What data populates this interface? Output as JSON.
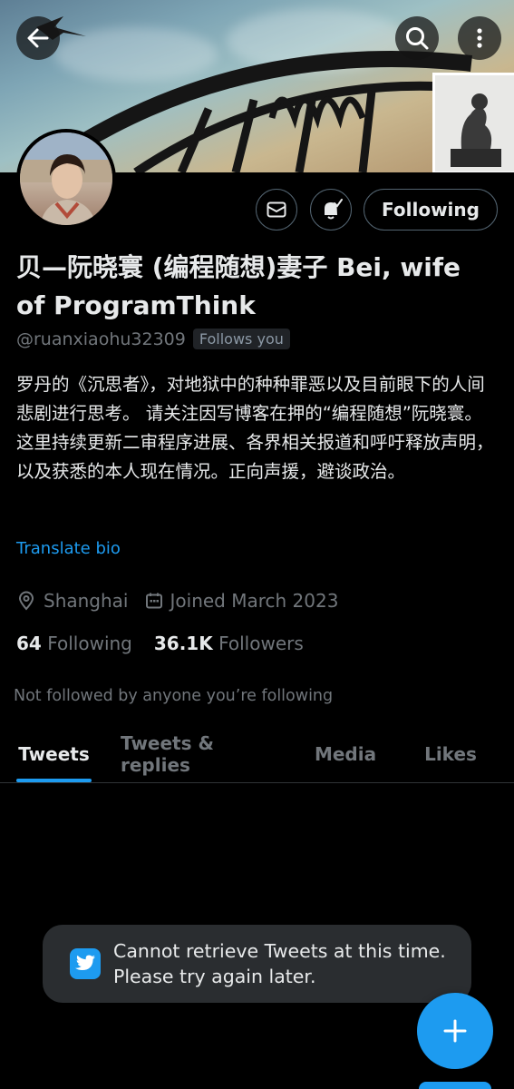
{
  "header": {
    "back_icon": "arrow-left-icon",
    "search_icon": "search-icon",
    "more_icon": "more-vertical-icon"
  },
  "profile": {
    "display_name": "贝—阮晓寰 (编程随想)妻子 Bei, wife of ProgramThink",
    "handle": "@ruanxiaohu32309",
    "follows_you": "Follows you",
    "bio": "罗丹的《沉思者》，对地狱中的种种罪恶以及目前眼下的人间悲剧进行思考。 请关注因写博客在押的“编程随想”阮晓寰。这里持续更新二审程序进展、各界相关报道和呼吁释放声明，以及获悉的本人现在情况。正向声援，避谈政治。",
    "translate_bio": "Translate bio",
    "location": "Shanghai",
    "joined": "Joined March 2023",
    "following_count": "64",
    "following_label": "Following",
    "followers_count": "36.1K",
    "followers_label": "Followers",
    "not_followed_text": "Not followed by anyone you’re following"
  },
  "actions": {
    "message_icon": "mail-icon",
    "notify_icon": "bell-check-icon",
    "following_button": "Following"
  },
  "tabs": [
    {
      "label": "Tweets",
      "active": true
    },
    {
      "label": "Tweets & replies",
      "active": false
    },
    {
      "label": "Media",
      "active": false
    },
    {
      "label": "Likes",
      "active": false
    }
  ],
  "toast": {
    "icon": "twitter-bird-icon",
    "message": "Cannot retrieve Tweets at this time. Please try again later."
  },
  "fab": {
    "icon": "plus-icon"
  },
  "colors": {
    "accent": "#1d9bf0",
    "background": "#000000",
    "muted": "#71767b"
  }
}
